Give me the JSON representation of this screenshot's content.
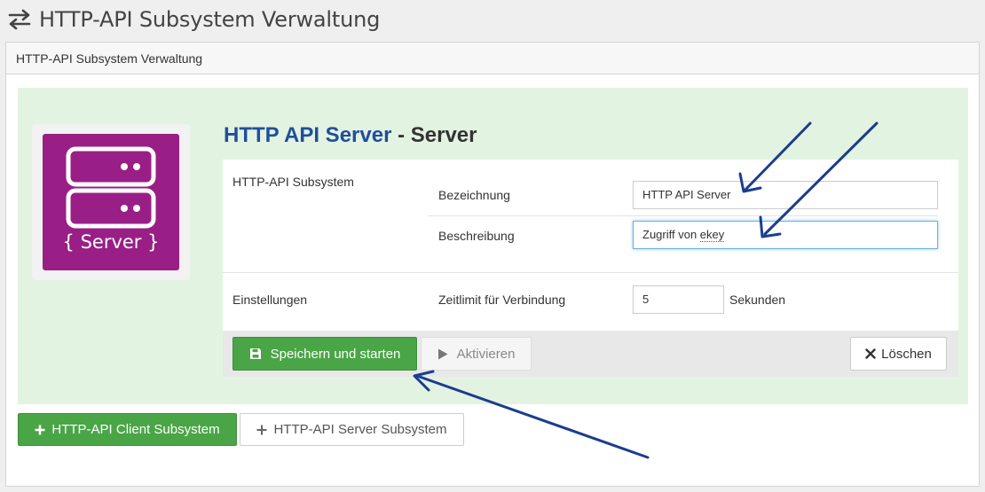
{
  "page": {
    "title": "HTTP-API Subsystem Verwaltung"
  },
  "panel": {
    "heading": "HTTP-API Subsystem Verwaltung"
  },
  "logo": {
    "label": "{ Server }",
    "color": "#991f86"
  },
  "server": {
    "name": "HTTP API Server",
    "separator": " - ",
    "type": "Server"
  },
  "sections": {
    "subsystem": {
      "label": "HTTP-API Subsystem",
      "fields": [
        {
          "label": "Bezeichnung",
          "value": "HTTP API Server"
        },
        {
          "label": "Beschreibung",
          "value_prefix": "Zugriff von ",
          "value_misspelled": "ekey"
        }
      ]
    },
    "settings": {
      "label": "Einstellungen",
      "timeout_label": "Zeitlimit für Verbindung",
      "timeout_value": "5",
      "timeout_unit": "Sekunden"
    }
  },
  "actions": {
    "save": "Speichern und starten",
    "activate": "Aktivieren",
    "delete": "Löschen"
  },
  "bottom_buttons": {
    "client": "HTTP-API Client Subsystem",
    "server": "HTTP-API Server Subsystem"
  },
  "colors": {
    "primary_green": "#4aa547",
    "brand_blue": "#1f4f9c",
    "annotation_arrow": "#1a3d8f",
    "highlight_bg": "#e3f3e1"
  }
}
